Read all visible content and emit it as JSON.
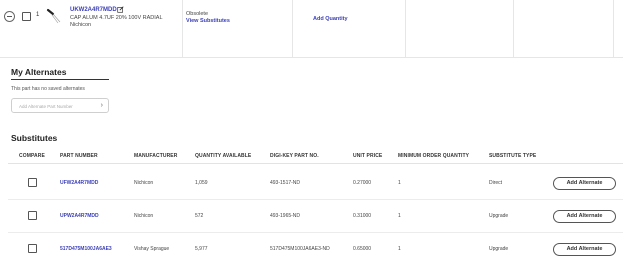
{
  "item": {
    "row_number": "1",
    "part_number": "UKW2A4R7MDD",
    "description": "CAP ALUM 4.7UF 20% 100V RADIAL",
    "manufacturer": "Nichicon",
    "status": "Obsolete",
    "view_substitutes": "View Substitutes",
    "add_quantity": "Add Quantity"
  },
  "my_alternates": {
    "title": "My Alternates",
    "note": "This part has no saved alternates",
    "input_placeholder": "Add Alternate Part Number"
  },
  "substitutes": {
    "title": "Substitutes",
    "headers": [
      "COMPARE",
      "PART NUMBER",
      "MANUFACTURER",
      "QUANTITY AVAILABLE",
      "DIGI-KEY PART NO.",
      "UNIT PRICE",
      "MINIMUM ORDER QUANTITY",
      "SUBSTITUTE TYPE"
    ],
    "add_button_label": "Add Alternate",
    "rows": [
      {
        "part_number": "UFW2A4R7MDD",
        "manufacturer": "Nichicon",
        "quantity": "1,059",
        "digikey_pn": "493-1517-ND",
        "unit_price": "0.27000",
        "min_qty": "1",
        "type": "Direct"
      },
      {
        "part_number": "UPW2A4R7MDD",
        "manufacturer": "Nichicon",
        "quantity": "572",
        "digikey_pn": "493-1965-ND",
        "unit_price": "0.31000",
        "min_qty": "1",
        "type": "Upgrade"
      },
      {
        "part_number": "517D475M100JA6AE3",
        "manufacturer": "Vishay Sprague",
        "quantity": "5,977",
        "digikey_pn": "517D475M100JA6AE3-ND",
        "unit_price": "0.65000",
        "min_qty": "1",
        "type": "Upgrade"
      }
    ]
  }
}
